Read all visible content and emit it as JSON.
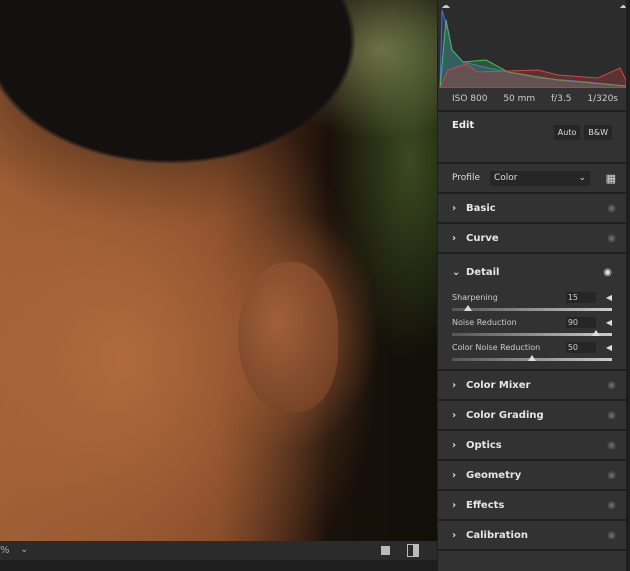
{
  "photo": {
    "description_alt": ""
  },
  "bottom_bar": {
    "zoom": "%",
    "zoom_chevron": "⌄"
  },
  "histogram": {
    "channels": [
      "red",
      "green",
      "blue"
    ],
    "colors": {
      "red": "#c84040",
      "green": "#40c060",
      "blue": "#4060c0"
    }
  },
  "info": {
    "iso": "ISO 800",
    "focal": "50 mm",
    "aperture": "f/3.5",
    "shutter": "1/320s"
  },
  "edit": {
    "title": "Edit",
    "auto": "Auto",
    "bw": "B&W"
  },
  "profile": {
    "label": "Profile",
    "value": "Color"
  },
  "sections": [
    {
      "label": "Basic",
      "expanded": false
    },
    {
      "label": "Curve",
      "expanded": false
    },
    {
      "label": "Detail",
      "expanded": true
    },
    {
      "label": "Color Mixer",
      "expanded": false
    },
    {
      "label": "Color Grading",
      "expanded": false
    },
    {
      "label": "Optics",
      "expanded": false
    },
    {
      "label": "Geometry",
      "expanded": false
    },
    {
      "label": "Effects",
      "expanded": false
    },
    {
      "label": "Calibration",
      "expanded": false
    }
  ],
  "detail": {
    "sliders": [
      {
        "label": "Sharpening",
        "value": "15",
        "min": 0,
        "max": 150
      },
      {
        "label": "Noise Reduction",
        "value": "90",
        "min": 0,
        "max": 100
      },
      {
        "label": "Color Noise Reduction",
        "value": "50",
        "min": 0,
        "max": 100
      }
    ]
  }
}
